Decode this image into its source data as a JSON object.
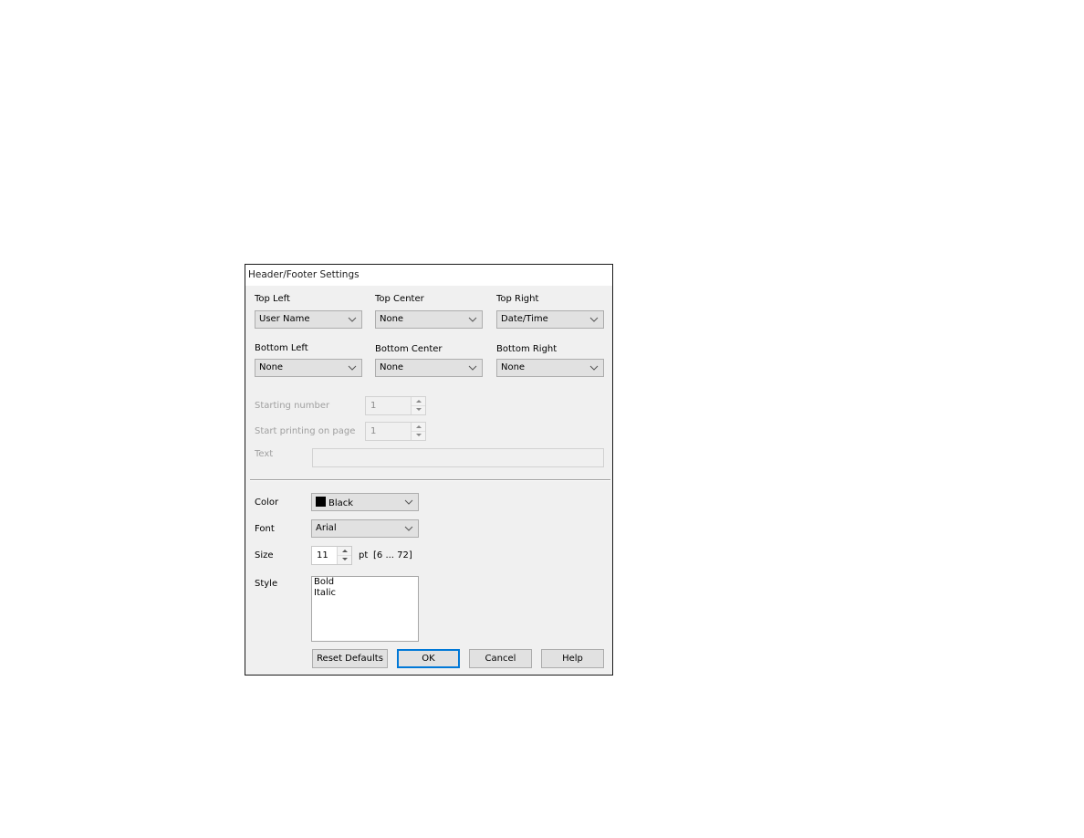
{
  "dialog": {
    "title": "Header/Footer Settings",
    "positions": {
      "top_left": {
        "label": "Top Left",
        "value": "User Name"
      },
      "top_center": {
        "label": "Top Center",
        "value": "None"
      },
      "top_right": {
        "label": "Top Right",
        "value": "Date/Time"
      },
      "bottom_left": {
        "label": "Bottom Left",
        "value": "None"
      },
      "bottom_center": {
        "label": "Bottom Center",
        "value": "None"
      },
      "bottom_right": {
        "label": "Bottom Right",
        "value": "None"
      }
    },
    "starting_number": {
      "label": "Starting number",
      "value": "1",
      "enabled": false
    },
    "start_printing_on_page": {
      "label": "Start printing on page",
      "value": "1",
      "enabled": false
    },
    "text": {
      "label": "Text",
      "value": "",
      "enabled": false
    },
    "color": {
      "label": "Color",
      "value": "Black",
      "swatch": "#000000"
    },
    "font": {
      "label": "Font",
      "value": "Arial"
    },
    "size": {
      "label": "Size",
      "value": "11",
      "unit": "pt",
      "range": "[6 ... 72]"
    },
    "style": {
      "label": "Style",
      "options": [
        "Bold",
        "Italic"
      ]
    },
    "buttons": {
      "reset": "Reset Defaults",
      "ok": "OK",
      "cancel": "Cancel",
      "help": "Help"
    },
    "accent_color": "#0078d7"
  }
}
